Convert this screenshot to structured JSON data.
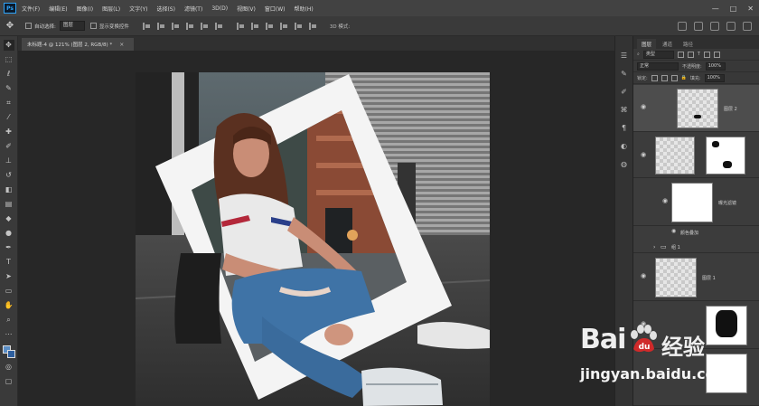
{
  "menu": {
    "logo": "Ps",
    "items": [
      "文件(F)",
      "编辑(E)",
      "图像(I)",
      "图层(L)",
      "文字(Y)",
      "选择(S)",
      "滤镜(T)",
      "3D(D)",
      "视图(V)",
      "窗口(W)",
      "帮助(H)"
    ],
    "minimize": "—",
    "maximize": "□",
    "close": "✕"
  },
  "options": {
    "auto_select_label": "自动选择:",
    "auto_select_value": "图层",
    "transform_label": "显示变换控件",
    "mode_3d_label": "3D 模式:"
  },
  "document": {
    "tab_title": "未标题-4 @ 121% (图层 2, RGB/8) *",
    "tab_close": "×"
  },
  "layers_panel": {
    "tabs": [
      "图层",
      "通道",
      "路径"
    ],
    "filter_label": "类型",
    "blend_mode": "正常",
    "opacity_label": "不透明度:",
    "opacity_value": "100%",
    "lock_label": "锁定:",
    "fill_label": "填充:",
    "fill_value": "100%",
    "layers": [
      {
        "name": "图层 2",
        "kind": "pixel",
        "selected": true
      },
      {
        "name": "",
        "kind": "smart-with-mask",
        "selected": false
      },
      {
        "name": "曝光滤镜",
        "kind": "filter",
        "selected": false
      },
      {
        "name": "颜色叠加",
        "kind": "effect",
        "selected": false
      },
      {
        "name": "组 1",
        "kind": "group",
        "selected": false
      },
      {
        "name": "图层 1",
        "kind": "pixel",
        "selected": false
      },
      {
        "name": "",
        "kind": "mask",
        "selected": false
      }
    ]
  },
  "watermark": {
    "brand_a": "Bai",
    "brand_b": "du",
    "brand_cn": "经验",
    "url": "jingyan.baidu.com"
  }
}
